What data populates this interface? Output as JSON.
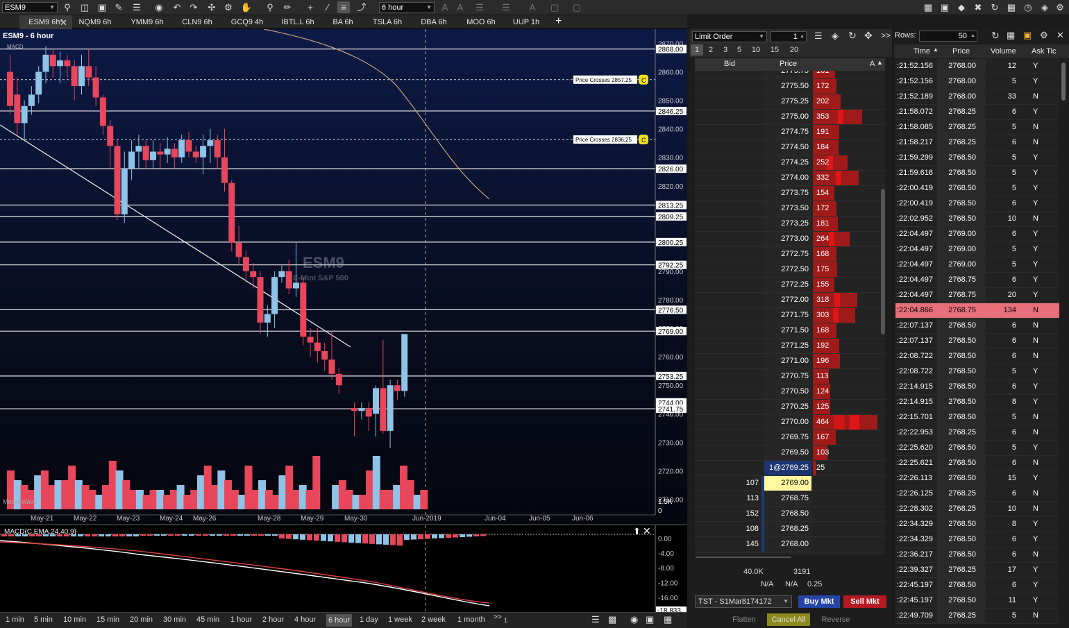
{
  "toolbar": {
    "symbol": "ESM9",
    "period": "6 hour"
  },
  "tabs": [
    {
      "label": "ESM9 6h*",
      "active": true
    },
    {
      "label": "NQM9 6h"
    },
    {
      "label": "YMM9 6h"
    },
    {
      "label": "CLN9 6h"
    },
    {
      "label": "GCQ9 4h"
    },
    {
      "label": "IBTL.L 6h"
    },
    {
      "label": "BA 6h"
    },
    {
      "label": "TSLA 6h"
    },
    {
      "label": "DBA 6h"
    },
    {
      "label": "MOO 6h"
    },
    {
      "label": "UUP 1h"
    }
  ],
  "add_tab": "+",
  "chart": {
    "title": "ESM9 - 6 hour",
    "sub": "MACD",
    "watermark_symbol": "ESM9",
    "watermark_name": "E-Mini S&P 500",
    "brand": "MotiveWave",
    "price_axis": [
      "2870.00",
      "2860.00",
      "2850.00",
      "2840.00",
      "2830.00",
      "2820.00",
      "2810.00",
      "2800.00",
      "2790.00",
      "2780.00",
      "2770.00",
      "2760.00",
      "2750.00",
      "2740.00",
      "2730.00",
      "2720.00",
      "2710.00"
    ],
    "level_labels": [
      "2868.00",
      "2846.25",
      "2826.00",
      "2813.25",
      "2809.25",
      "2800.25",
      "2792.25",
      "2776.50",
      "2769.00",
      "2753.25",
      "2744.00",
      "2741.75"
    ],
    "volume_label": "1.5K",
    "volume_zero": "0",
    "alerts": [
      {
        "text": "Price Crosses 2857.25",
        "badge": "C"
      },
      {
        "text": "Price Crosses 2836.25",
        "badge": "C"
      }
    ],
    "dates": [
      "May-21",
      "May-22",
      "May-23",
      "May-24",
      "May-26",
      "May-28",
      "May-29",
      "May-30",
      "Jun-2019",
      "Jun-04",
      "Jun-05",
      "Jun-06"
    ]
  },
  "macd": {
    "title": "MACD(C,EMA,24,40,9)",
    "axis": [
      "0.00",
      "-4.00",
      "-8.00",
      "-12.00",
      "-16.00"
    ],
    "current": "-18.833"
  },
  "timeframes": [
    {
      "label": "1 min"
    },
    {
      "label": "5 min"
    },
    {
      "label": "10 min"
    },
    {
      "label": "15 min"
    },
    {
      "label": "20 min"
    },
    {
      "label": "30 min"
    },
    {
      "label": "45 min"
    },
    {
      "label": "1 hour"
    },
    {
      "label": "2 hour"
    },
    {
      "label": "4 hour"
    },
    {
      "label": "6 hour",
      "active": true
    },
    {
      "label": "1 day"
    },
    {
      "label": "1 week"
    },
    {
      "label": "2 week"
    },
    {
      "label": "1 month"
    }
  ],
  "timeframes_more": ">>",
  "timeframes_count": "1",
  "dom": {
    "order_type": "Limit Order",
    "quantity": "1",
    "qty_buttons": [
      "1",
      "2",
      "3",
      "5",
      "10",
      "15",
      "20"
    ],
    "headers": {
      "bid": "Bid",
      "price": "Price",
      "ask": "A"
    },
    "asks": [
      {
        "price": "2775.75",
        "size": "161"
      },
      {
        "price": "2775.50",
        "size": "172"
      },
      {
        "price": "2775.25",
        "size": "202"
      },
      {
        "price": "2775.00",
        "size": "353"
      },
      {
        "price": "2774.75",
        "size": "191"
      },
      {
        "price": "2774.50",
        "size": "184"
      },
      {
        "price": "2774.25",
        "size": "252"
      },
      {
        "price": "2774.00",
        "size": "332"
      },
      {
        "price": "2773.75",
        "size": "154"
      },
      {
        "price": "2773.50",
        "size": "172"
      },
      {
        "price": "2773.25",
        "size": "181"
      },
      {
        "price": "2773.00",
        "size": "264"
      },
      {
        "price": "2772.75",
        "size": "168"
      },
      {
        "price": "2772.50",
        "size": "175"
      },
      {
        "price": "2772.25",
        "size": "155"
      },
      {
        "price": "2772.00",
        "size": "318"
      },
      {
        "price": "2771.75",
        "size": "303"
      },
      {
        "price": "2771.50",
        "size": "168"
      },
      {
        "price": "2771.25",
        "size": "192"
      },
      {
        "price": "2771.00",
        "size": "196"
      },
      {
        "price": "2770.75",
        "size": "113"
      },
      {
        "price": "2770.50",
        "size": "124"
      },
      {
        "price": "2770.25",
        "size": "125"
      },
      {
        "price": "2770.00",
        "size": "464"
      },
      {
        "price": "2769.75",
        "size": "167"
      },
      {
        "price": "2769.50",
        "size": "103"
      },
      {
        "price": "1@2769.25",
        "size": "25"
      }
    ],
    "bids": [
      {
        "price": "2769.00",
        "size": "107"
      },
      {
        "price": "2768.75",
        "size": "113"
      },
      {
        "price": "2768.50",
        "size": "152"
      },
      {
        "price": "2768.25",
        "size": "108"
      },
      {
        "price": "2768.00",
        "size": "145"
      }
    ],
    "total_bid": "40.0K",
    "total_ask": "3191",
    "na1": "N/A",
    "na2": "N/A",
    "tick": "0.25",
    "account": "TST - S1Mar8174172",
    "buy_mkt": "Buy Mkt",
    "sell_mkt": "Sell Mkt",
    "flatten": "Flatten",
    "cancel_all": "Cancel All",
    "reverse": "Reverse"
  },
  "tas": {
    "rows_label": "Rows:",
    "rows_value": "50",
    "headers": {
      "time": "Time",
      "price": "Price",
      "volume": "Volume",
      "ask_tick": "Ask Tic"
    },
    "rows": [
      {
        "t": ":21:52.156",
        "p": "2768.00",
        "v": "12",
        "a": "Y"
      },
      {
        "t": ":21:52.156",
        "p": "2768.00",
        "v": "5",
        "a": "Y"
      },
      {
        "t": ":21:52.189",
        "p": "2768.00",
        "v": "33",
        "a": "N"
      },
      {
        "t": ":21:58.072",
        "p": "2768.25",
        "v": "6",
        "a": "Y"
      },
      {
        "t": ":21:58.085",
        "p": "2768.25",
        "v": "5",
        "a": "N"
      },
      {
        "t": ":21:58.217",
        "p": "2768.25",
        "v": "6",
        "a": "N"
      },
      {
        "t": ":21:59.299",
        "p": "2768.50",
        "v": "5",
        "a": "Y"
      },
      {
        "t": ":21:59.616",
        "p": "2768.50",
        "v": "5",
        "a": "Y"
      },
      {
        "t": ":22:00.419",
        "p": "2768.50",
        "v": "5",
        "a": "Y"
      },
      {
        "t": ":22:00.419",
        "p": "2768.50",
        "v": "6",
        "a": "Y"
      },
      {
        "t": ":22:02.952",
        "p": "2768.50",
        "v": "10",
        "a": "N"
      },
      {
        "t": ":22:04.497",
        "p": "2769.00",
        "v": "6",
        "a": "Y"
      },
      {
        "t": ":22:04.497",
        "p": "2769.00",
        "v": "5",
        "a": "Y"
      },
      {
        "t": ":22:04.497",
        "p": "2769.00",
        "v": "5",
        "a": "Y"
      },
      {
        "t": ":22:04.497",
        "p": "2768.75",
        "v": "6",
        "a": "Y"
      },
      {
        "t": ":22:04.497",
        "p": "2768.75",
        "v": "20",
        "a": "Y"
      },
      {
        "t": ":22:04.866",
        "p": "2768.75",
        "v": "134",
        "a": "N",
        "hl": true
      },
      {
        "t": ":22:07.137",
        "p": "2768.50",
        "v": "6",
        "a": "N"
      },
      {
        "t": ":22:07.137",
        "p": "2768.50",
        "v": "6",
        "a": "N"
      },
      {
        "t": ":22:08.722",
        "p": "2768.50",
        "v": "6",
        "a": "N"
      },
      {
        "t": ":22:08.722",
        "p": "2768.50",
        "v": "5",
        "a": "Y"
      },
      {
        "t": ":22:14.915",
        "p": "2768.50",
        "v": "6",
        "a": "Y"
      },
      {
        "t": ":22:14.915",
        "p": "2768.50",
        "v": "8",
        "a": "Y"
      },
      {
        "t": ":22:15.701",
        "p": "2768.50",
        "v": "5",
        "a": "N"
      },
      {
        "t": ":22:22.953",
        "p": "2768.25",
        "v": "6",
        "a": "N"
      },
      {
        "t": ":22:25.620",
        "p": "2768.50",
        "v": "5",
        "a": "Y"
      },
      {
        "t": ":22:25.621",
        "p": "2768.50",
        "v": "6",
        "a": "N"
      },
      {
        "t": ":22:26.113",
        "p": "2768.50",
        "v": "15",
        "a": "Y"
      },
      {
        "t": ":22:26.125",
        "p": "2768.25",
        "v": "6",
        "a": "N"
      },
      {
        "t": ":22:28.302",
        "p": "2768.25",
        "v": "10",
        "a": "N"
      },
      {
        "t": ":22:34.329",
        "p": "2768.50",
        "v": "8",
        "a": "Y"
      },
      {
        "t": ":22:34.329",
        "p": "2768.50",
        "v": "6",
        "a": "Y"
      },
      {
        "t": ":22:36.217",
        "p": "2768.50",
        "v": "6",
        "a": "N"
      },
      {
        "t": ":22:39.327",
        "p": "2768.25",
        "v": "17",
        "a": "Y"
      },
      {
        "t": ":22:45.197",
        "p": "2768.50",
        "v": "6",
        "a": "Y"
      },
      {
        "t": ":22:45.197",
        "p": "2768.50",
        "v": "11",
        "a": "Y"
      },
      {
        "t": ":22:49.709",
        "p": "2768.25",
        "v": "5",
        "a": "N"
      }
    ]
  },
  "colors": {
    "up": "#8fc3e8",
    "down": "#e8465a",
    "ask_bar": "#b31b1b",
    "bid_bar": "#1d4a92",
    "highlight": "#e9707a",
    "buy": "#2546a8",
    "sell": "#b51a22",
    "cancel": "#8c8a1e"
  },
  "chart_data": {
    "type": "candlestick",
    "candles": [
      [
        2860,
        2866,
        2845,
        2848
      ],
      [
        2852,
        2858,
        2838,
        2842
      ],
      [
        2842,
        2850,
        2836,
        2848
      ],
      [
        2848,
        2855,
        2845,
        2852
      ],
      [
        2852,
        2862,
        2849,
        2860
      ],
      [
        2860,
        2869,
        2856,
        2866
      ],
      [
        2866,
        2868,
        2858,
        2862
      ],
      [
        2862,
        2867,
        2856,
        2864
      ],
      [
        2864,
        2866,
        2858,
        2862
      ],
      [
        2862,
        2864,
        2850,
        2855
      ],
      [
        2855,
        2866,
        2852,
        2862
      ],
      [
        2862,
        2868,
        2855,
        2858
      ],
      [
        2858,
        2862,
        2848,
        2851
      ],
      [
        2851,
        2852,
        2838,
        2841
      ],
      [
        2841,
        2843,
        2826,
        2834
      ],
      [
        2834,
        2836,
        2808,
        2810
      ],
      [
        2810,
        2832,
        2807,
        2826
      ],
      [
        2826,
        2836,
        2822,
        2832
      ],
      [
        2832,
        2838,
        2826,
        2834
      ],
      [
        2834,
        2836,
        2826,
        2829
      ],
      [
        2829,
        2836,
        2826,
        2832
      ],
      [
        2832,
        2835,
        2826,
        2831
      ],
      [
        2831,
        2837,
        2828,
        2833
      ],
      [
        2833,
        2835,
        2826,
        2830
      ],
      [
        2830,
        2838,
        2828,
        2836
      ],
      [
        2836,
        2839,
        2830,
        2832
      ],
      [
        2832,
        2834,
        2828,
        2830
      ],
      [
        2830,
        2838,
        2824,
        2834
      ],
      [
        2834,
        2840,
        2828,
        2836
      ],
      [
        2836,
        2838,
        2826,
        2830
      ],
      [
        2830,
        2840,
        2818,
        2821
      ],
      [
        2821,
        2822,
        2797,
        2800
      ],
      [
        2800,
        2806,
        2792,
        2795
      ],
      [
        2795,
        2797,
        2786,
        2790
      ],
      [
        2790,
        2793,
        2784,
        2788
      ],
      [
        2788,
        2790,
        2768,
        2772
      ],
      [
        2772,
        2778,
        2767,
        2775
      ],
      [
        2775,
        2790,
        2770,
        2788
      ],
      [
        2788,
        2792,
        2786,
        2790
      ],
      [
        2790,
        2794,
        2782,
        2784
      ],
      [
        2784,
        2800,
        2781,
        2786
      ],
      [
        2786,
        2788,
        2764,
        2767
      ],
      [
        2767,
        2770,
        2760,
        2765
      ],
      [
        2765,
        2770,
        2758,
        2762
      ],
      [
        2762,
        2765,
        2755,
        2759
      ],
      [
        2759,
        2769,
        2752,
        2754
      ],
      [
        2754,
        2756,
        2747,
        2750
      ],
      [
        2742,
        2744,
        2732,
        2741
      ],
      [
        2741,
        2744,
        2738,
        2742
      ],
      [
        2742,
        2744,
        2734,
        2739
      ],
      [
        2740,
        2750,
        2732,
        2749
      ],
      [
        2749,
        2766,
        2733,
        2734
      ],
      [
        2734,
        2752,
        2728,
        2750
      ],
      [
        2750,
        2752,
        2745,
        2748
      ],
      [
        2748,
        2768,
        2746,
        2768
      ]
    ],
    "volume": [
      40,
      30,
      25,
      20,
      35,
      40,
      25,
      30,
      30,
      45,
      30,
      25,
      20,
      15,
      25,
      50,
      40,
      30,
      20,
      20,
      15,
      20,
      20,
      15,
      20,
      25,
      15,
      20,
      35,
      45,
      25,
      40,
      30,
      20,
      15,
      45,
      20,
      30,
      20,
      15,
      35,
      45,
      20,
      25,
      20,
      55,
      25,
      30,
      20,
      15,
      15,
      40,
      55,
      20,
      20,
      25,
      45,
      30,
      15,
      20
    ],
    "y_range": [
      2705,
      2874
    ],
    "levels": [
      2868,
      2846.25,
      2826,
      2813.25,
      2809.25,
      2800.25,
      2792.25,
      2776.5,
      2769,
      2753.25,
      2741.75
    ],
    "alert_levels": [
      2857.25,
      2836.25
    ],
    "macd_range": [
      -19,
      1
    ]
  }
}
